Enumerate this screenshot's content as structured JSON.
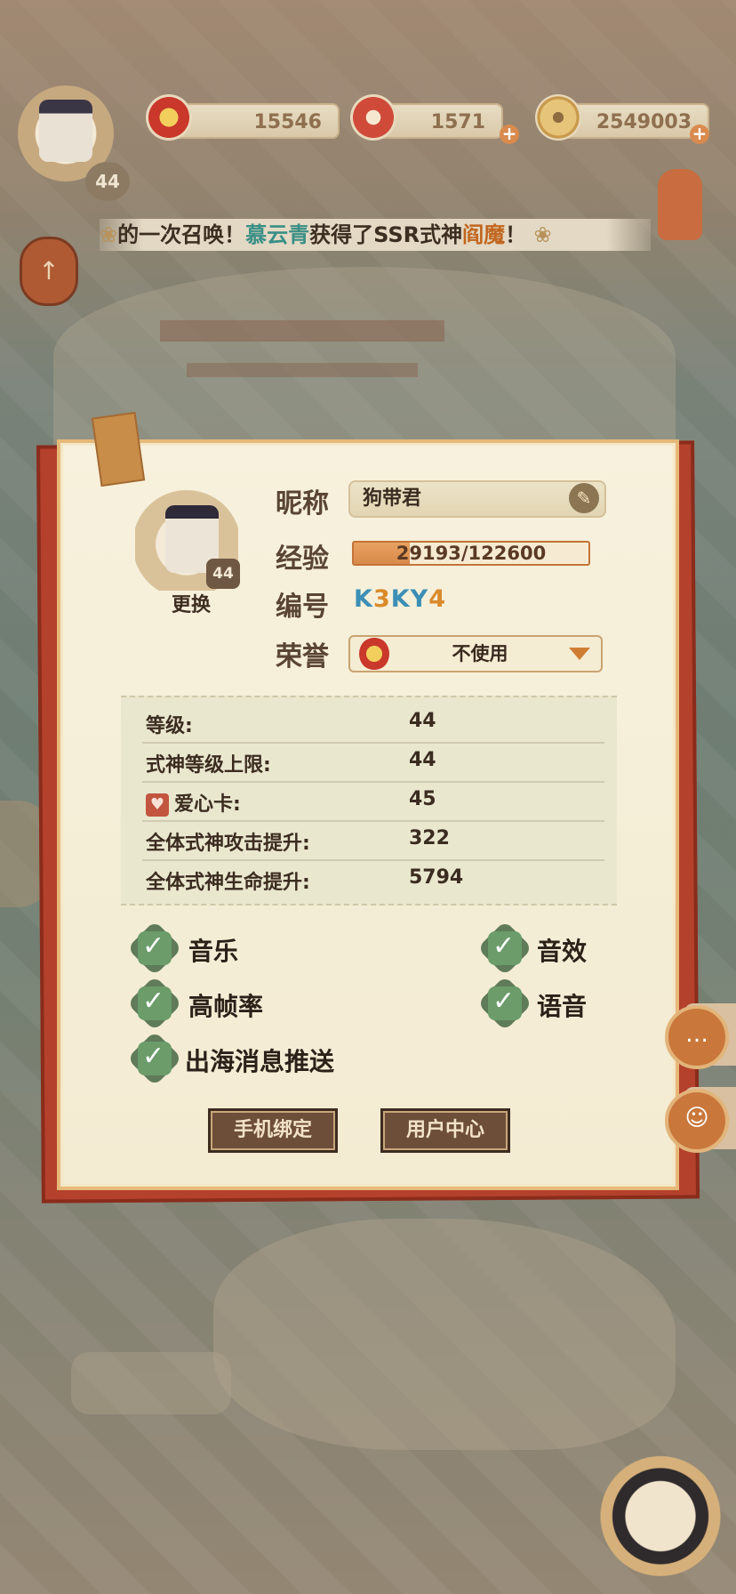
{
  "top_bar": {
    "player_level": "44",
    "resources": [
      {
        "name": "honor-points",
        "icon": "plum-blossom-icon",
        "value": "15546",
        "has_plus": false
      },
      {
        "name": "magatama",
        "icon": "magatama-icon",
        "value": "1571",
        "has_plus": true
      },
      {
        "name": "gold",
        "icon": "coin-icon",
        "value": "2549003",
        "has_plus": true
      }
    ]
  },
  "marquee": {
    "prefix": "的一次召唤！",
    "player": "慕云青",
    "middle": "获得了SSR式神",
    "shikigami": "阎魔",
    "suffix": "！"
  },
  "profile": {
    "portrait_level": "44",
    "change_label": "更换",
    "nickname_label": "昵称",
    "nickname_value": "狗带君",
    "exp_label": "经验",
    "exp_text": "29193/122600",
    "exp_fraction": 0.238,
    "id_label": "编号",
    "id_parts": [
      "K",
      "3",
      "KY",
      "4"
    ],
    "honor_label": "荣誉",
    "honor_value": "不使用"
  },
  "stats": [
    {
      "label": "等级:",
      "value": "44"
    },
    {
      "label": "式神等级上限:",
      "value": "44"
    },
    {
      "label": "爱心卡:",
      "value": "45",
      "icon": "heart-card-icon"
    },
    {
      "label": "全体式神攻击提升:",
      "value": "322"
    },
    {
      "label": "全体式神生命提升:",
      "value": "5794"
    }
  ],
  "settings": {
    "music": "音乐",
    "sfx": "音效",
    "high_fps": "高帧率",
    "voice": "语音",
    "push": "出海消息推送"
  },
  "buttons": {
    "phone_bind": "手机绑定",
    "user_center": "用户中心"
  },
  "colors": {
    "panel_border": "#b4412c",
    "check_green": "#6b9c6a",
    "id_blue": "#3c8fb5",
    "id_orange": "#d98a2b",
    "marquee_player": "#3a8f86",
    "marquee_shikigami": "#c2661f"
  }
}
